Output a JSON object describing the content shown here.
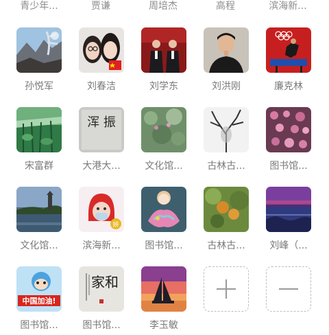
{
  "top_row": [
    "青少年...",
    "贾谦",
    "周培杰",
    "高程",
    "滨海新..."
  ],
  "members": [
    {
      "label": "孙悦军",
      "photo": "mountain-tree-photo"
    },
    {
      "label": "刘春洁",
      "photo": "two-girls-selfie-photo"
    },
    {
      "label": "刘学东",
      "photo": "two-men-red-curtain-photo"
    },
    {
      "label": "刘洪刚",
      "photo": "man-portrait-photo"
    },
    {
      "label": "廉克林",
      "photo": "olympic-athlete-photo"
    },
    {
      "label": "宋富群",
      "photo": "green-leaves-photo"
    },
    {
      "label": "大港大...",
      "photo": "calligraphy-photo"
    },
    {
      "label": "文化馆...",
      "photo": "green-plants-photo"
    },
    {
      "label": "古林古...",
      "photo": "ink-tree-photo"
    },
    {
      "label": "图书馆...",
      "photo": "pink-blossom-photo"
    },
    {
      "label": "文化馆...",
      "photo": "pagoda-lake-photo"
    },
    {
      "label": "滨海新...",
      "photo": "cartoon-girl-mask-photo"
    },
    {
      "label": "图书馆...",
      "photo": "doll-flower-photo"
    },
    {
      "label": "古林古...",
      "photo": "persimmon-tree-photo"
    },
    {
      "label": "刘峰（...",
      "photo": "purple-seascape-photo"
    },
    {
      "label": "图书馆...",
      "photo": "china-jiayou-cartoon-photo"
    },
    {
      "label": "图书馆...",
      "photo": "calligraphy-jiahe-photo"
    },
    {
      "label": "李玉敏",
      "photo": "sailboat-sunset-photo"
    }
  ],
  "tile_texts": {
    "calligraphy": "浑 振",
    "badge": "妍",
    "jiayou": "中国加油!",
    "jiahe": "家和"
  },
  "actions": {
    "add_icon": "plus-icon",
    "remove_icon": "minus-icon"
  },
  "colors": {
    "label_gray": "#7a7a7a",
    "dashed_border": "#bdbdbd"
  }
}
